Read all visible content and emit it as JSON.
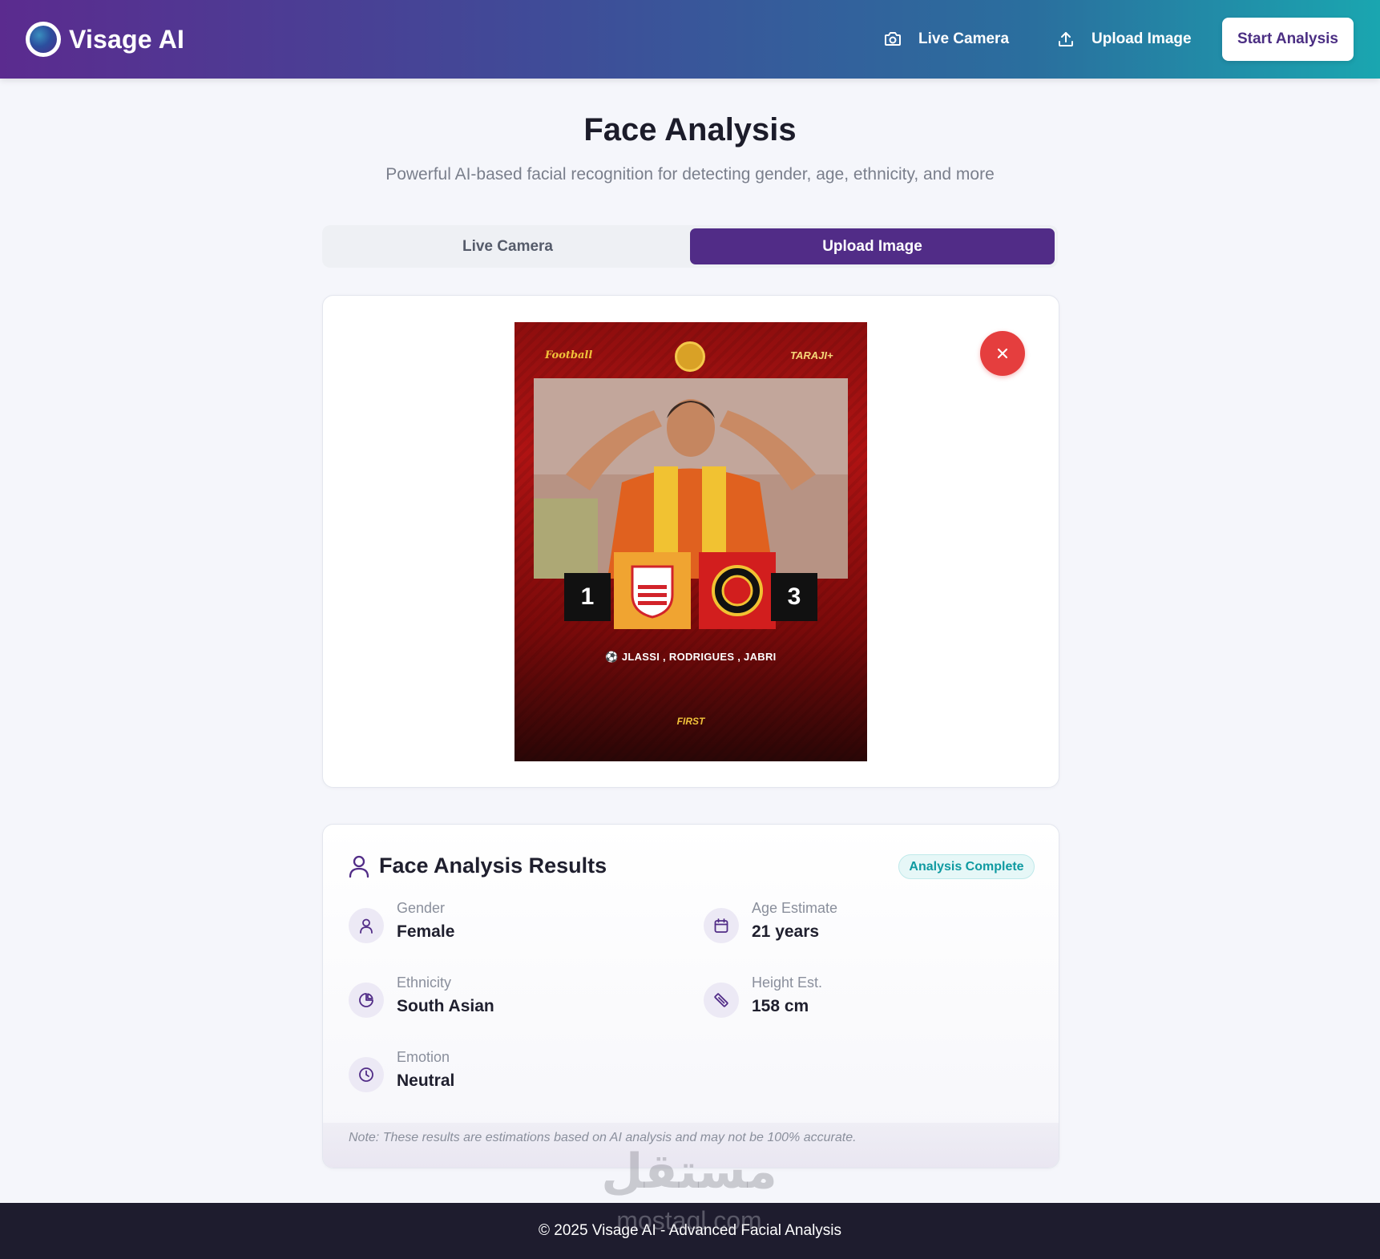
{
  "header": {
    "brand_name": "Visage AI",
    "nav": [
      {
        "label": "Live Camera",
        "icon": "camera-icon"
      },
      {
        "label": "Upload Image",
        "icon": "upload-icon"
      }
    ],
    "cta_label": "Start Analysis"
  },
  "hero": {
    "title": "Face Analysis",
    "subtitle": "Powerful AI-based facial recognition for detecting gender, age, ethnicity, and more"
  },
  "tabs": [
    {
      "label": "Live Camera",
      "active": false
    },
    {
      "label": "Upload Image",
      "active": true
    }
  ],
  "uploaded_image": {
    "top_left_text": "Football",
    "top_right_text": "TARAJI+",
    "score_left": "1",
    "score_right": "3",
    "scorers": "JLASSI , RODRIGUES , JABRI",
    "sponsor_text": "FIRST",
    "remove_icon": "close-icon"
  },
  "results": {
    "title": "Face Analysis Results",
    "status_badge": "Analysis Complete",
    "items": [
      {
        "label": "Gender",
        "value": "Female",
        "icon": "user-icon"
      },
      {
        "label": "Age Estimate",
        "value": "21 years",
        "icon": "calendar-icon"
      },
      {
        "label": "Ethnicity",
        "value": "South Asian",
        "icon": "pie-chart-icon"
      },
      {
        "label": "Height Est.",
        "value": "158 cm",
        "icon": "ruler-icon"
      },
      {
        "label": "Emotion",
        "value": "Neutral",
        "icon": "clock-icon"
      }
    ],
    "note": "Note: These results are estimations based on AI analysis and may not be 100% accurate."
  },
  "watermark": {
    "arabic": "مستقل",
    "latin": "mostaql.com"
  },
  "footer": {
    "text": "© 2025 Visage AI - Advanced Facial Analysis"
  },
  "colors": {
    "brand_purple": "#512c87",
    "danger": "#e53e3e",
    "teal": "#0f9aa1",
    "footer_bg": "#1e1c2e"
  }
}
